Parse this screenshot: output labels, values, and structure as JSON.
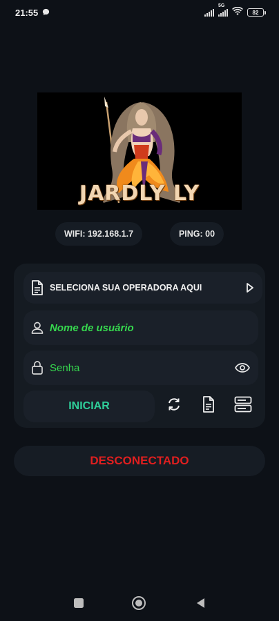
{
  "status_bar": {
    "time": "21:55",
    "network_label": "5G",
    "battery_label": "82"
  },
  "logo": {
    "text": "JARDLY LY"
  },
  "info": {
    "wifi_label": "WIFI: 192.168.1.7",
    "ping_label": "PING: 00"
  },
  "form": {
    "operator_label": "SELECIONA SUA OPERADORA AQUI",
    "username_placeholder": "Nome de usuário",
    "password_placeholder": "Senha",
    "start_button": "INICIAR"
  },
  "connection_status": "DESCONECTADO",
  "colors": {
    "background": "#0d1117",
    "card": "#151b22",
    "accent_green": "#36d84e",
    "start_teal": "#2fcf9a",
    "status_red": "#e01f1f"
  },
  "icons": {
    "operator": "document-icon",
    "operator_arrow": "play-arrow-icon",
    "user": "user-icon",
    "lock": "lock-icon",
    "visibility": "eye-icon",
    "refresh": "refresh-icon",
    "logs": "document-icon",
    "servers": "server-icon"
  }
}
